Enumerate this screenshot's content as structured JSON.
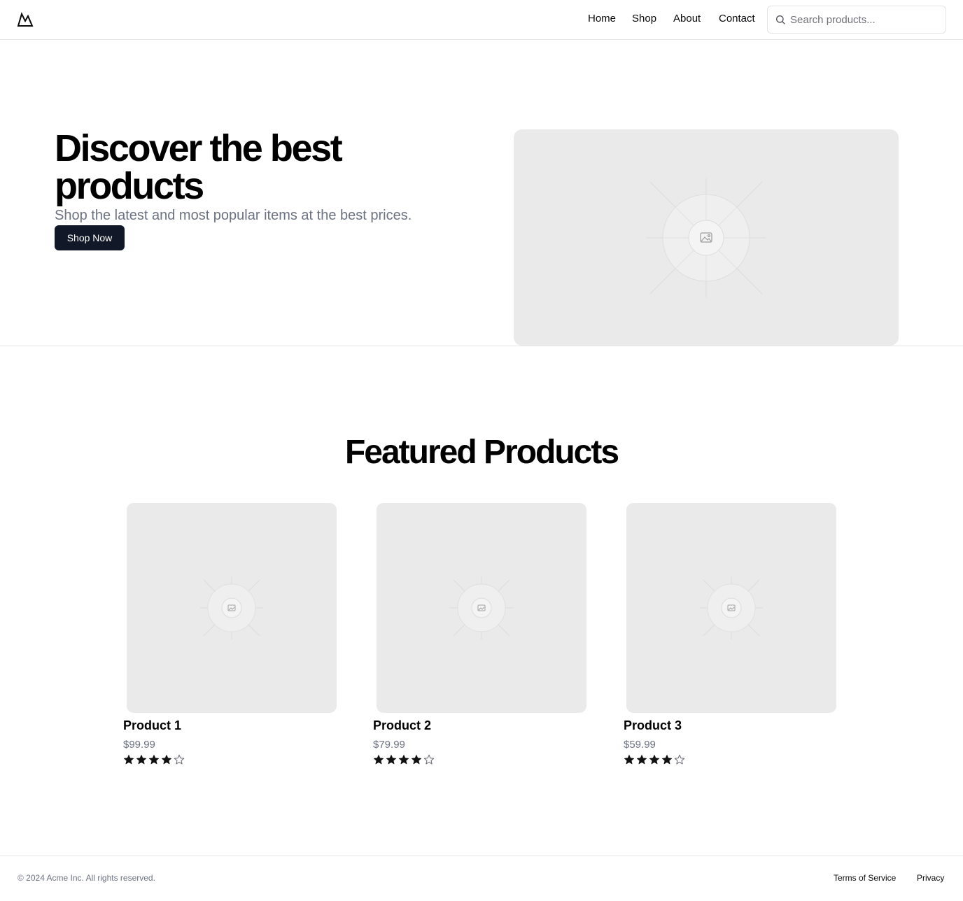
{
  "header": {
    "logo_icon": "mountain-icon",
    "nav": [
      "Home",
      "Shop",
      "About",
      "Contact"
    ],
    "search": {
      "placeholder": "Search products...",
      "value": "",
      "icon": "search-icon"
    }
  },
  "hero": {
    "title": "Discover the best products",
    "subtitle": "Shop the latest and most popular items at the best prices.",
    "cta": "Shop Now",
    "image_icon": "image-placeholder-icon"
  },
  "featured": {
    "title": "Featured Products",
    "products": [
      {
        "name": "Product 1",
        "price": "$99.99",
        "rating": 4,
        "rating_max": 5
      },
      {
        "name": "Product 2",
        "price": "$79.99",
        "rating": 4,
        "rating_max": 5
      },
      {
        "name": "Product 3",
        "price": "$59.99",
        "rating": 4,
        "rating_max": 5
      }
    ]
  },
  "footer": {
    "copyright": "© 2024 Acme Inc. All rights reserved.",
    "links": [
      "Terms of Service",
      "Privacy"
    ]
  },
  "colors": {
    "primary_button": "#111827",
    "muted_text": "#6b7280",
    "placeholder_bg": "#eaeaea",
    "border": "#e5e5e5"
  }
}
